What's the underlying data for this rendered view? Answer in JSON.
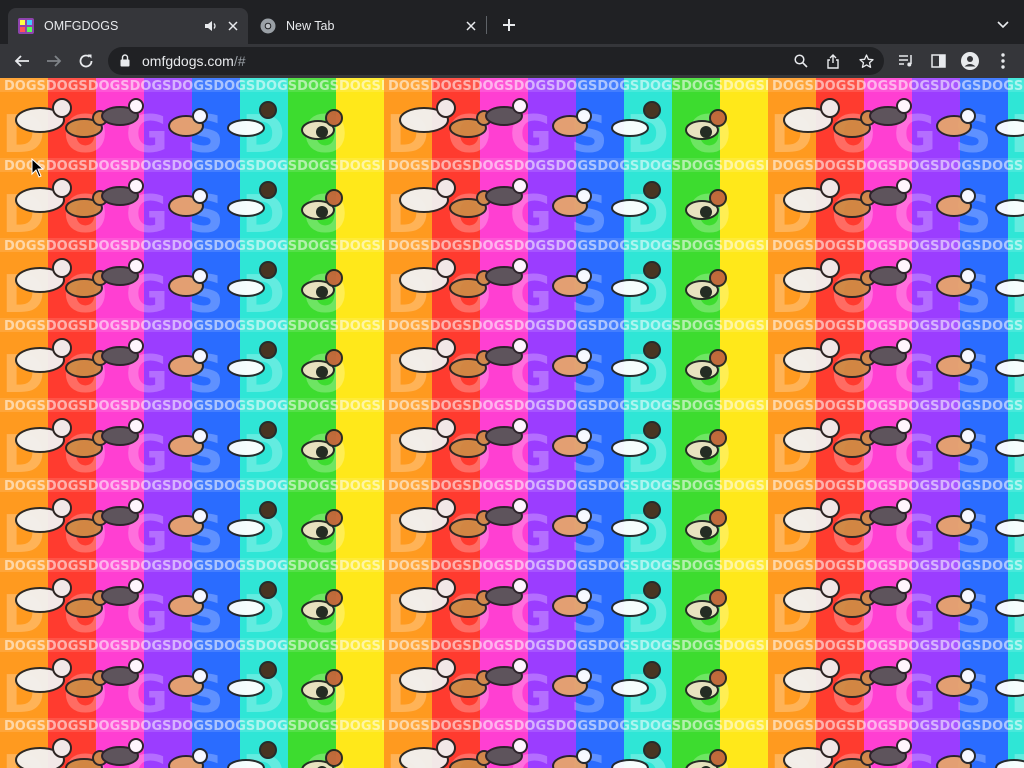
{
  "browser": {
    "tabs": [
      {
        "title": "OMFGDOGS",
        "active": true,
        "audio": true,
        "favicon": "omfgdogs-favicon"
      },
      {
        "title": "New Tab",
        "active": false,
        "audio": false,
        "favicon": "chrome-icon"
      }
    ],
    "address": {
      "host": "omfgdogs.com",
      "path": "/#"
    },
    "icons": {
      "back": "arrow-left-icon",
      "forward": "arrow-right-icon",
      "reload": "reload-icon",
      "lock": "lock-icon",
      "search": "search-icon",
      "share": "share-icon",
      "bookmark": "star-icon",
      "media": "media-control-icon",
      "sidepanel": "side-panel-icon",
      "profile": "profile-icon",
      "menu": "kebab-menu-icon"
    },
    "colors": {
      "frame": "#202124",
      "toolbar": "#35363a",
      "omnibox": "#202124",
      "text": "#e8eaed"
    }
  },
  "page": {
    "background_text": "DOGS",
    "rainbow_colors": [
      "#ff3b2f",
      "#ff9a1f",
      "#ffe81a",
      "#3ddc2f",
      "#2fe6d6",
      "#2a6cff",
      "#9b3dff",
      "#ff3fd2"
    ]
  }
}
